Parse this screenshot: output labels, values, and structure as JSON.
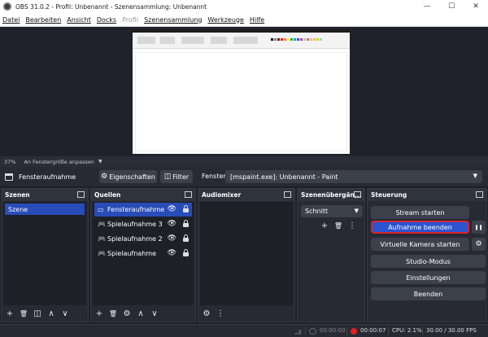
{
  "window": {
    "title": "OBS 31.0.2 - Profil: Unbenannt - Szenensammlung: Unbenannt",
    "minimize": "—",
    "maximize": "☐",
    "close": "✕"
  },
  "menu": [
    "Datei",
    "Bearbeiten",
    "Ansicht",
    "Docks",
    "Profil",
    "Szenensammlung",
    "Werkzeuge",
    "Hilfe"
  ],
  "preview": {
    "zoom": "37%",
    "fit_label": "An Fenstergröße anpassen",
    "fit_caret": "▼"
  },
  "source_toolbar": {
    "source_name": "Fensteraufnahme",
    "properties_label": "Eigenschaften",
    "filter_label": "Filter",
    "window_label": "Fenster",
    "window_value": "[mspaint.exe]: Unbenannt - Paint",
    "caret": "▼"
  },
  "docks": {
    "scenes": {
      "title": "Szenen",
      "items": [
        "Szene"
      ]
    },
    "sources": {
      "title": "Quellen",
      "items": [
        {
          "label": "Fensteraufnahme",
          "icon": "monitor-icon"
        },
        {
          "label": "Spielaufnahme 3",
          "icon": "gamepad-icon"
        },
        {
          "label": "Spielaufnahme 2",
          "icon": "gamepad-icon"
        },
        {
          "label": "Spielaufnahme",
          "icon": "gamepad-icon"
        }
      ]
    },
    "mixer": {
      "title": "Audiomixer"
    },
    "transitions": {
      "title": "Szenenübergän...",
      "selected": "Schnitt",
      "caret": "▼"
    },
    "controls": {
      "title": "Steuerung",
      "buttons": [
        "Stream starten",
        "Aufnahme beenden",
        "Virtuelle Kamera starten",
        "Studio-Modus",
        "Einstellungen",
        "Beenden"
      ]
    }
  },
  "statusbar": {
    "stream_time": "00:00:00",
    "rec_time": "00:00:07",
    "cpu": "CPU: 2.1%",
    "fps": "30.00 / 30.00 FPS"
  },
  "glyphs": {
    "gear": "⚙",
    "filter": "◫",
    "plus": "+",
    "trash": "🗑",
    "up": "∧",
    "down": "∨",
    "eye": "👁",
    "dots": "⋮",
    "pause": "❚❚",
    "gamepad": "🎮"
  },
  "colors": {
    "accent": "#284cb8",
    "record_border": "#d9252a",
    "record_dot": "#e02020"
  }
}
